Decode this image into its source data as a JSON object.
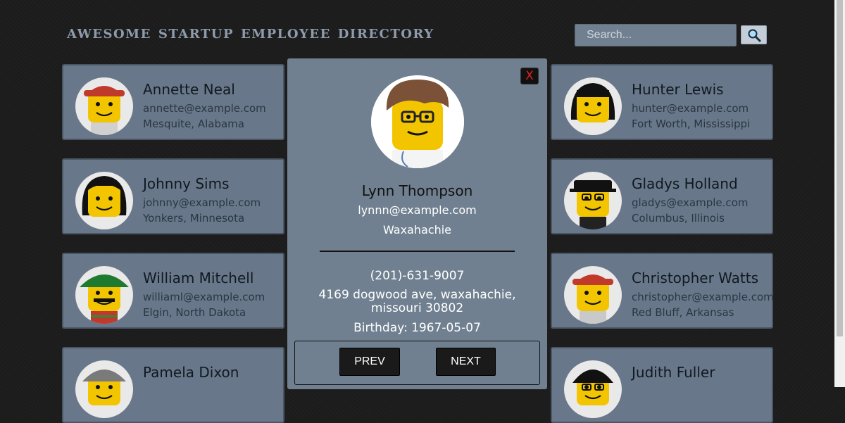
{
  "header": {
    "brand_words": [
      "AWESOME",
      "STARTUP",
      "EMPLOYEE",
      "DIRECTORY"
    ],
    "search_placeholder": "Search...",
    "search_icon": "magnifier-icon"
  },
  "employees": [
    {
      "name": "Annette Neal",
      "email": "annette@example.com",
      "location": "Mesquite, Alabama"
    },
    {
      "name": "Hunter Lewis",
      "email": "hunter@example.com",
      "location": "Fort Worth, Mississippi"
    },
    {
      "name": "Johnny Sims",
      "email": "johnny@example.com",
      "location": "Yonkers, Minnesota"
    },
    {
      "name": "Gladys Holland",
      "email": "gladys@example.com",
      "location": "Columbus, Illinois"
    },
    {
      "name": "William Mitchell",
      "email": "williaml@example.com",
      "location": "Elgin, North Dakota"
    },
    {
      "name": "Christopher Watts",
      "email": "christopher@example.com",
      "location": "Red Bluff, Arkansas"
    },
    {
      "name": "Pamela Dixon",
      "email": "",
      "location": ""
    },
    {
      "name": "Judith Fuller",
      "email": "",
      "location": ""
    }
  ],
  "modal": {
    "close_label": "X",
    "name": "Lynn Thompson",
    "email": "lynnn@example.com",
    "city": "Waxahachie",
    "phone": "(201)-631-9007",
    "address": "4169 dogwood ave, waxahachie, missouri 30802",
    "birthday": "Birthday: 1967-05-07",
    "prev_label": "PREV",
    "next_label": "NEXT"
  },
  "colors": {
    "background": "#1c1c1c",
    "card": "#68788a",
    "modal": "#708090",
    "close_text": "#e02020"
  }
}
